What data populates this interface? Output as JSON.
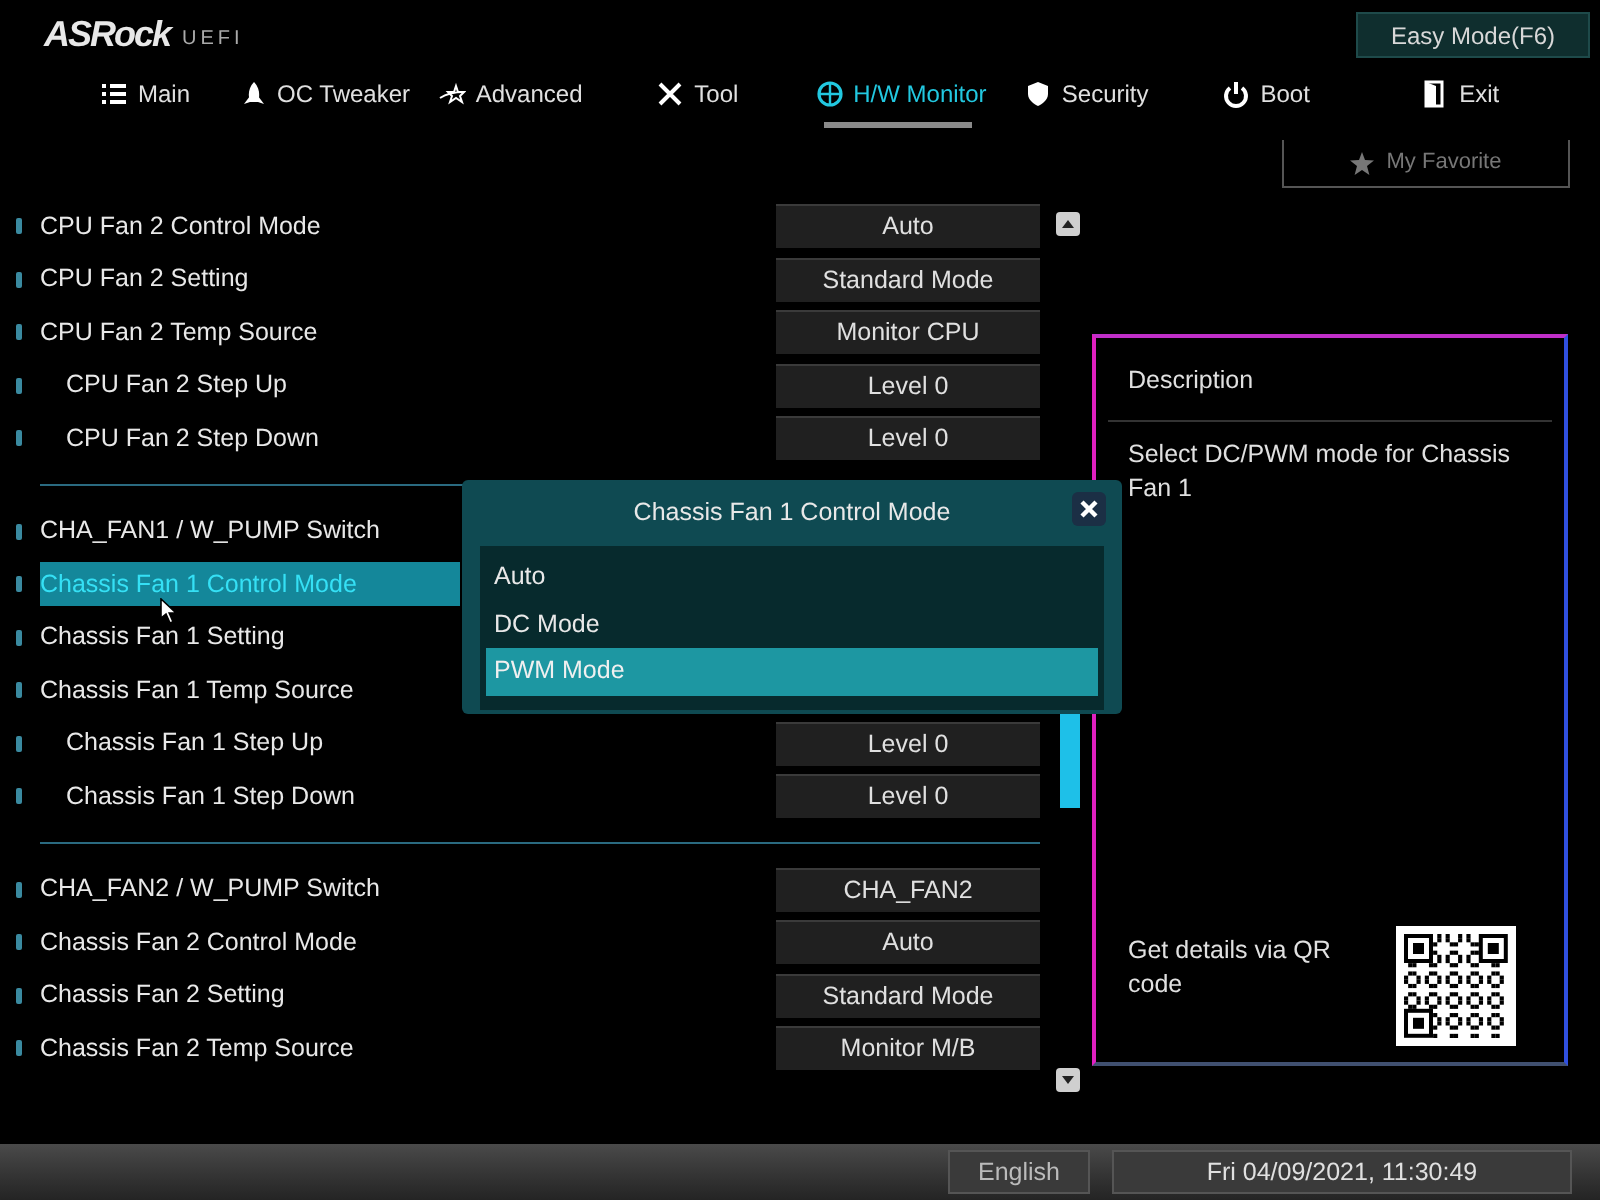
{
  "header": {
    "logo": "ASRock",
    "logo_suffix": "UEFI",
    "easy_mode_button": "Easy Mode(F6)"
  },
  "tabs": [
    {
      "label": "Main",
      "selected": false
    },
    {
      "label": "OC Tweaker",
      "selected": false
    },
    {
      "label": "Advanced",
      "selected": false
    },
    {
      "label": "Tool",
      "selected": false
    },
    {
      "label": "H/W Monitor",
      "selected": true
    },
    {
      "label": "Security",
      "selected": false
    },
    {
      "label": "Boot",
      "selected": false
    },
    {
      "label": "Exit",
      "selected": false
    }
  ],
  "favorite_button": "My Favorite",
  "settings_groups": [
    {
      "rows": [
        {
          "label": "CPU Fan 2 Control Mode",
          "value": "Auto",
          "selected": false
        },
        {
          "label": "CPU Fan 2 Setting",
          "value": "Standard Mode",
          "selected": false
        },
        {
          "label": "CPU Fan 2 Temp Source",
          "value": "Monitor CPU",
          "selected": false,
          "children": [
            {
              "label": "CPU Fan 2 Step Up",
              "value": "Level 0",
              "selected": false
            },
            {
              "label": "CPU Fan 2 Step Down",
              "value": "Level 0",
              "selected": false
            }
          ]
        }
      ]
    },
    {
      "rows": [
        {
          "label": "CHA_FAN1 / W_PUMP Switch",
          "selected": false
        },
        {
          "label": "Chassis Fan 1 Control Mode",
          "selected": true
        },
        {
          "label": "Chassis Fan 1 Setting",
          "selected": false
        },
        {
          "label": "Chassis Fan 1 Temp Source",
          "selected": false,
          "children": [
            {
              "label": "Chassis Fan 1 Step Up",
              "value": "Level 0",
              "selected": false
            },
            {
              "label": "Chassis Fan 1 Step Down",
              "value": "Level 0",
              "selected": false
            }
          ]
        }
      ]
    },
    {
      "rows": [
        {
          "label": "CHA_FAN2 / W_PUMP Switch",
          "value": "CHA_FAN2",
          "selected": false
        },
        {
          "label": "Chassis Fan 2 Control Mode",
          "value": "Auto",
          "selected": false
        },
        {
          "label": "Chassis Fan 2 Setting",
          "value": "Standard Mode",
          "selected": false
        },
        {
          "label": "Chassis Fan 2 Temp Source",
          "value": "Monitor M/B",
          "selected": false
        }
      ]
    }
  ],
  "dialog": {
    "title": "Chassis Fan 1 Control Mode",
    "options": [
      {
        "label": "Auto",
        "selected": false
      },
      {
        "label": "DC Mode",
        "selected": false
      },
      {
        "label": "PWM Mode",
        "selected": true
      }
    ]
  },
  "description": {
    "title": "Description",
    "text": "Select DC/PWM mode for Chassis Fan 1",
    "qr_text": "Get details via QR code"
  },
  "status_bar": {
    "language": "English",
    "datetime": "Fri 04/09/2021, 11:30:49"
  }
}
